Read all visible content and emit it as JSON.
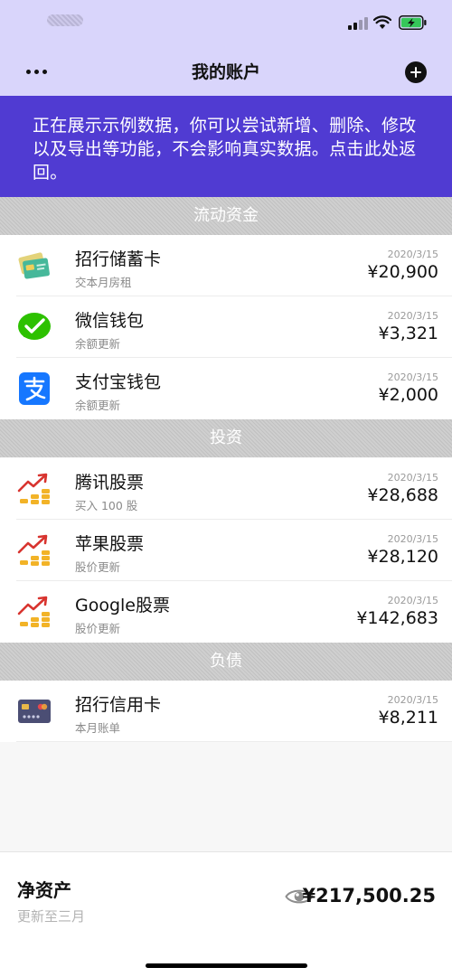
{
  "colors": {
    "accent": "#503bd2",
    "nav_bg": "#d9d5fb",
    "battery": "#35c759"
  },
  "nav": {
    "title": "我的账户",
    "more_icon": "more-dots-icon",
    "add_icon": "plus-circle-icon"
  },
  "banner": {
    "text": "正在展示示例数据，你可以尝试新增、删除、修改以及导出等功能，不会影响真实数据。点击此处返回。"
  },
  "sections": [
    {
      "title": "流动资金",
      "accounts": [
        {
          "name": "招行储蓄卡",
          "note": "交本月房租",
          "date": "2020/3/15",
          "amount": "¥20,900",
          "icon": "debit-card-icon"
        },
        {
          "name": "微信钱包",
          "note": "余额更新",
          "date": "2020/3/15",
          "amount": "¥3,321",
          "icon": "wechat-icon"
        },
        {
          "name": "支付宝钱包",
          "note": "余额更新",
          "date": "2020/3/15",
          "amount": "¥2,000",
          "icon": "alipay-icon"
        }
      ]
    },
    {
      "title": "投资",
      "accounts": [
        {
          "name": "腾讯股票",
          "note": "买入 100 股",
          "date": "2020/3/15",
          "amount": "¥28,688",
          "icon": "stock-chart-icon"
        },
        {
          "name": "苹果股票",
          "note": "股价更新",
          "date": "2020/3/15",
          "amount": "¥28,120",
          "icon": "stock-chart-icon"
        },
        {
          "name": "Google股票",
          "note": "股价更新",
          "date": "2020/3/15",
          "amount": "¥142,683",
          "icon": "stock-chart-icon"
        }
      ]
    },
    {
      "title": "负债",
      "accounts": [
        {
          "name": "招行信用卡",
          "note": "本月账单",
          "date": "2020/3/15",
          "amount": "¥8,211",
          "icon": "credit-card-icon"
        }
      ]
    }
  ],
  "footer": {
    "label": "净资产",
    "subtitle": "更新至三月",
    "amount": "¥217,500.25",
    "eye_icon": "eye-icon"
  }
}
